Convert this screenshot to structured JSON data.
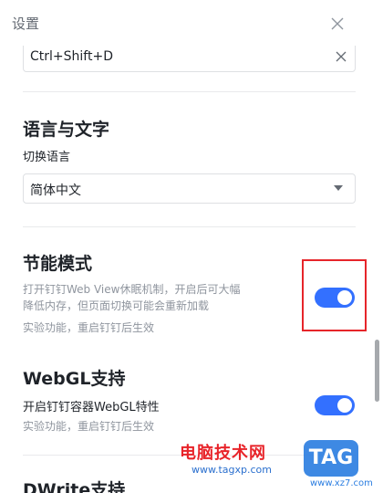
{
  "window": {
    "title": "设置"
  },
  "shortcut": {
    "value": "Ctrl+Shift+D"
  },
  "language": {
    "section_title": "语言与文字",
    "switch_label": "切换语言",
    "selected": "简体中文"
  },
  "power_saving": {
    "section_title": "节能模式",
    "desc_line1": "打开钉钉Web View休眠机制，开启后可大幅",
    "desc_line2": "降低内存，但页面切换可能会重新加载",
    "note": "实验功能，重启钉钉后生效",
    "enabled": true
  },
  "webgl": {
    "section_title": "WebGL支持",
    "label": "开启钉钉容器WebGL特性",
    "note": "实验功能，重启钉钉后生效",
    "enabled": true
  },
  "dwrite": {
    "section_title": "DWrite支持"
  },
  "watermark": {
    "brand": "电脑技术网",
    "url": "www.tagxp.com",
    "tag": "TAG",
    "site": "www.xz7.com"
  },
  "colors": {
    "accent": "#3370ff",
    "highlight": "#e6252a"
  }
}
